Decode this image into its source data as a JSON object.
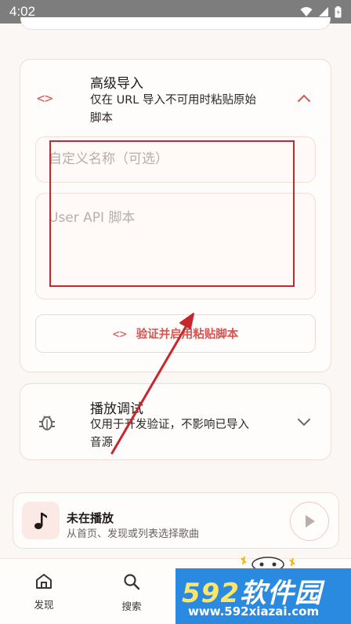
{
  "status_bar": {
    "time": "4:02"
  },
  "advanced_import": {
    "title": "高级导入",
    "subtitle_line1": "仅在 URL 导入不可用时粘贴原始",
    "subtitle_line2": "脚本",
    "name_placeholder": "自定义名称（可选）",
    "script_placeholder": "User API 脚本",
    "verify_button_label": "验证并启用粘贴脚本"
  },
  "debug_section": {
    "title": "播放调试",
    "subtitle_line1": "仅用于开发验证，不影响已导入",
    "subtitle_line2": "音源"
  },
  "player": {
    "title": "未在播放",
    "subtitle": "从首页、发现或列表选择歌曲"
  },
  "bottom_nav": {
    "items": [
      {
        "label": "发现",
        "icon": "home-icon"
      },
      {
        "label": "搜索",
        "icon": "search-icon"
      }
    ]
  },
  "watermark": {
    "brand_number": "592",
    "brand_text": "软件园",
    "url": "www.592xiazai.com"
  },
  "colors": {
    "accent": "#d9534f",
    "annotation": "#c8252d",
    "watermark_blue": "#2a8ae0"
  }
}
